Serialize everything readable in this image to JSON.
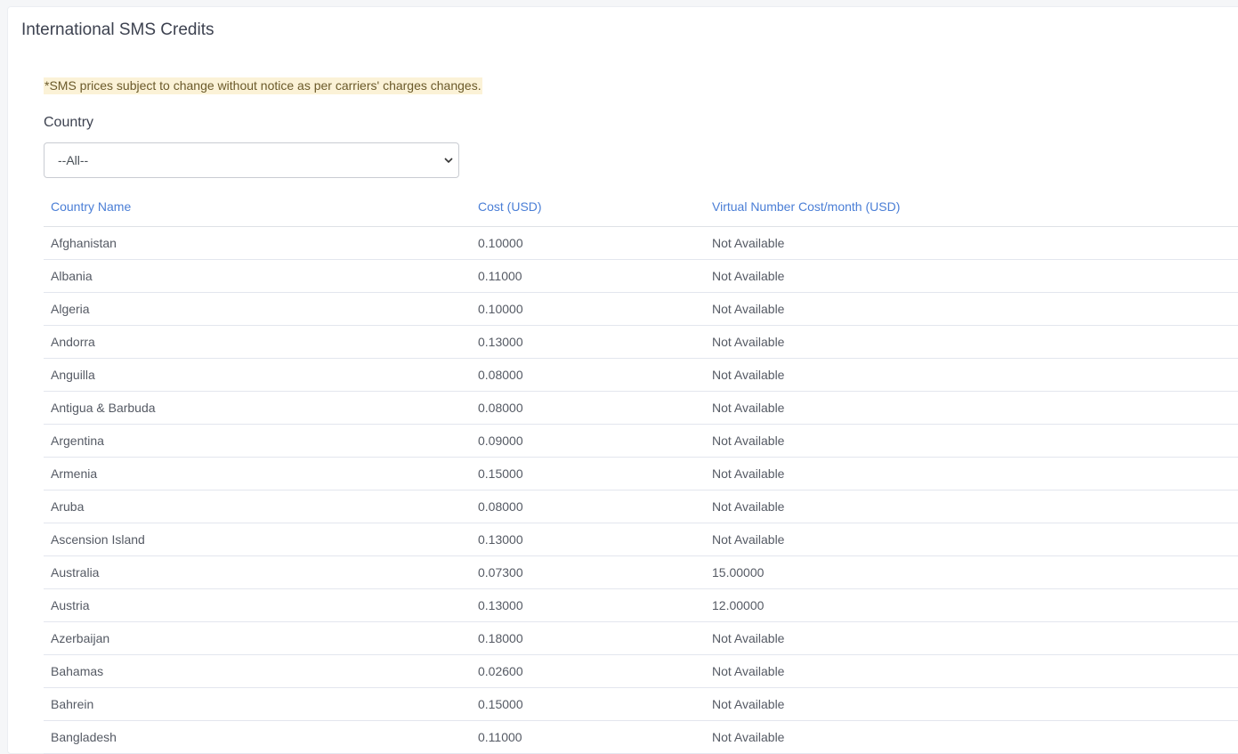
{
  "card": {
    "title": "International SMS Credits",
    "notice": "*SMS prices subject to change without notice as per carriers' charges changes.",
    "country_label": "Country",
    "country_select": {
      "selected": "--All--"
    }
  },
  "table": {
    "headers": [
      "Country Name",
      "Cost (USD)",
      "Virtual Number Cost/month (USD)"
    ],
    "rows": [
      [
        "Afghanistan",
        "0.10000",
        "Not Available"
      ],
      [
        "Albania",
        "0.11000",
        "Not Available"
      ],
      [
        "Algeria",
        "0.10000",
        "Not Available"
      ],
      [
        "Andorra",
        "0.13000",
        "Not Available"
      ],
      [
        "Anguilla",
        "0.08000",
        "Not Available"
      ],
      [
        "Antigua & Barbuda",
        "0.08000",
        "Not Available"
      ],
      [
        "Argentina",
        "0.09000",
        "Not Available"
      ],
      [
        "Armenia",
        "0.15000",
        "Not Available"
      ],
      [
        "Aruba",
        "0.08000",
        "Not Available"
      ],
      [
        "Ascension Island",
        "0.13000",
        "Not Available"
      ],
      [
        "Australia",
        "0.07300",
        "15.00000"
      ],
      [
        "Austria",
        "0.13000",
        "12.00000"
      ],
      [
        "Azerbaijan",
        "0.18000",
        "Not Available"
      ],
      [
        "Bahamas",
        "0.02600",
        "Not Available"
      ],
      [
        "Bahrein",
        "0.15000",
        "Not Available"
      ],
      [
        "Bangladesh",
        "0.11000",
        "Not Available"
      ]
    ]
  },
  "icons": {
    "select_chevron": "chevron-down-icon"
  },
  "colors": {
    "header_link": "#4a7ed6",
    "notice_bg": "#fbf2d7"
  }
}
